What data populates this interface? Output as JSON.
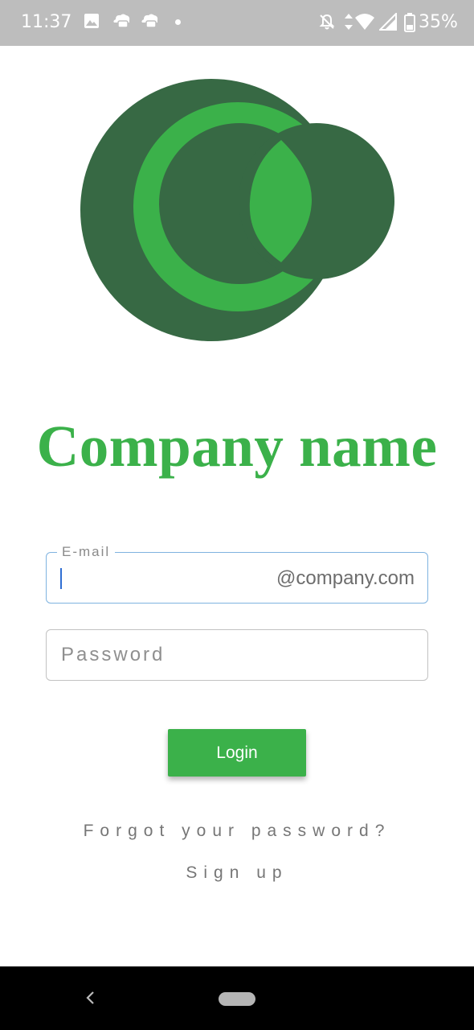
{
  "status_bar": {
    "time": "11:37",
    "battery": "35%",
    "icons": [
      "image-icon",
      "cloud-game-icon",
      "cloud-game-icon",
      "notification-dot",
      "mute-icon",
      "data-arrows-icon",
      "wifi-icon",
      "cell-signal-icon",
      "battery-icon"
    ]
  },
  "colors": {
    "brand_green": "#3bb14a",
    "logo_dark_green": "#376944",
    "focus_blue": "#7fb3e0"
  },
  "company_name": "Company name",
  "email": {
    "label": "E-mail",
    "value": "",
    "suffix": "@company.com"
  },
  "password": {
    "placeholder": "Password"
  },
  "login_label": "Login",
  "forgot_password": "Forgot your password?",
  "sign_up": "Sign up",
  "nav": {
    "icons": [
      "back-icon",
      "home-pill"
    ]
  }
}
